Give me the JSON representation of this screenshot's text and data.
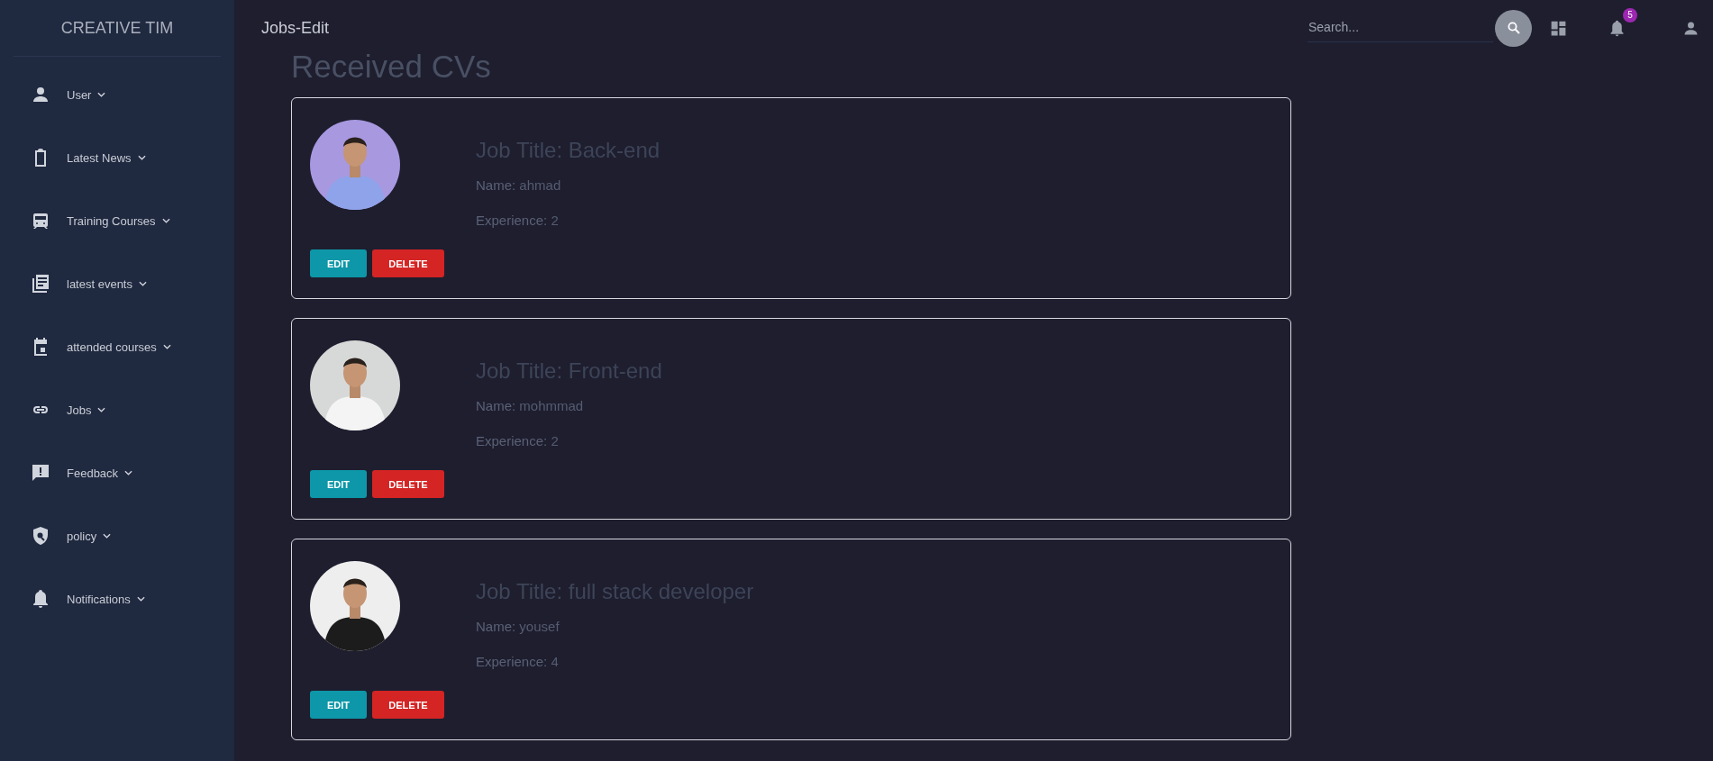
{
  "sidebar": {
    "brand": "CREATIVE TIM",
    "items": [
      {
        "label": "User"
      },
      {
        "label": "Latest News"
      },
      {
        "label": "Training Courses"
      },
      {
        "label": "latest events"
      },
      {
        "label": "attended courses"
      },
      {
        "label": "Jobs"
      },
      {
        "label": "Feedback"
      },
      {
        "label": "policy"
      },
      {
        "label": "Notifications"
      }
    ]
  },
  "header": {
    "title": "Jobs-Edit",
    "search": {
      "placeholder": "Search..."
    },
    "notification_count": "5"
  },
  "heading": "Received CVs",
  "cvs": [
    {
      "job_title_label": "Job Title:",
      "job_title": "Back-end",
      "name_label": "Name:",
      "name": "ahmad",
      "experience_label": "Experience:",
      "experience": "2",
      "edit": "EDIT",
      "delete": "DELETE"
    },
    {
      "job_title_label": "Job Title:",
      "job_title": "Front-end",
      "name_label": "Name:",
      "name": "mohmmad",
      "experience_label": "Experience:",
      "experience": "2",
      "edit": "EDIT",
      "delete": "DELETE"
    },
    {
      "job_title_label": "Job Title:",
      "job_title": "full stack developer",
      "name_label": "Name:",
      "name": "yousef",
      "experience_label": "Experience:",
      "experience": "4",
      "edit": "EDIT",
      "delete": "DELETE"
    }
  ]
}
